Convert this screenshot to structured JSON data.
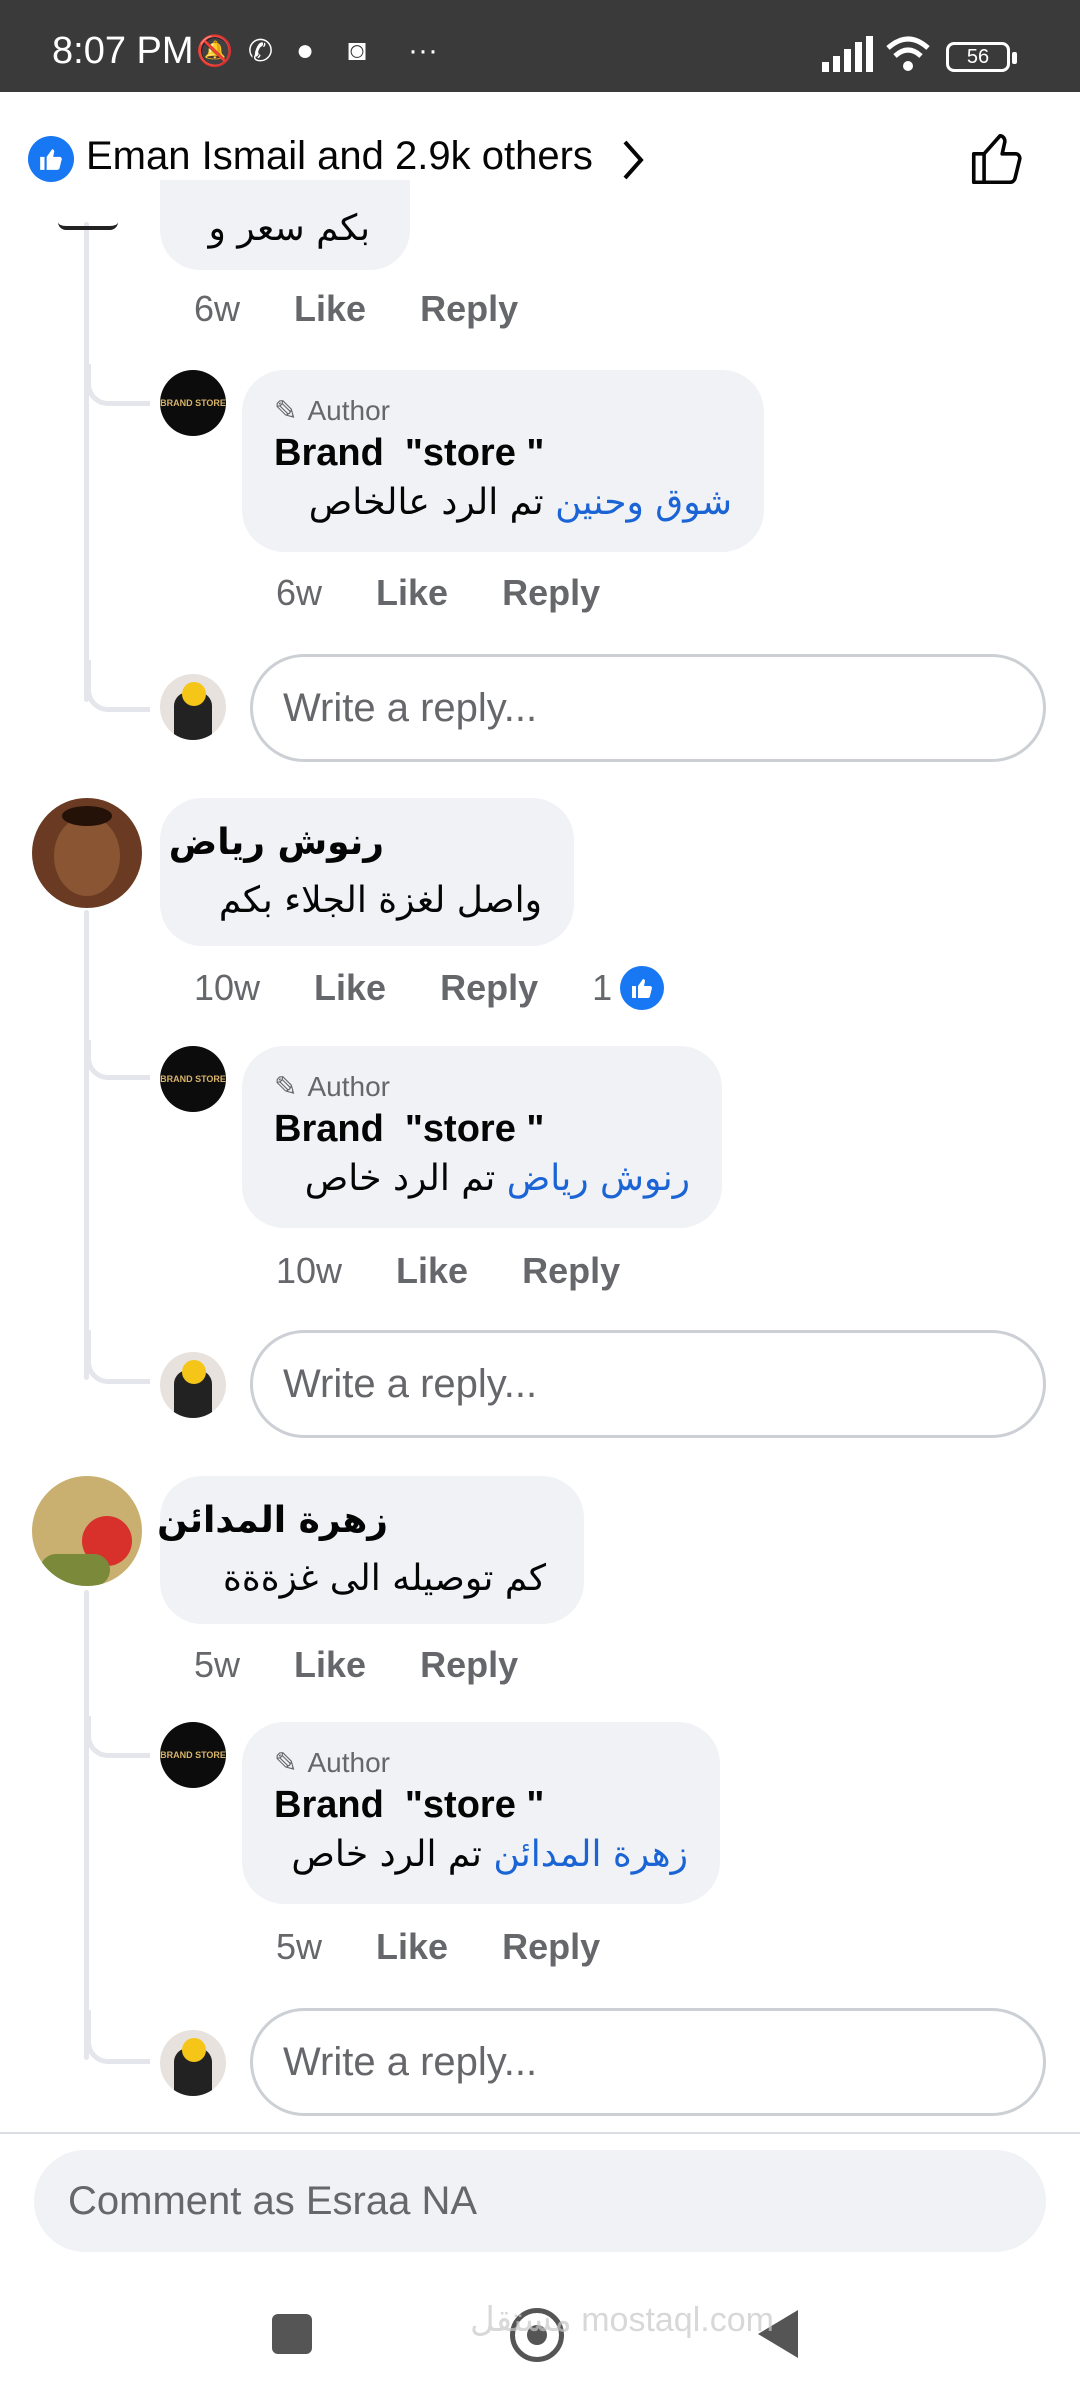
{
  "status_bar": {
    "time": "8:07 PM",
    "battery": "56"
  },
  "header": {
    "reactions_text": "Eman Ismail and 2.9k others"
  },
  "threads": [
    {
      "partial_comment_text": "بكم سعر و",
      "meta": {
        "time": "6w",
        "like": "Like",
        "reply": "Reply"
      },
      "reply": {
        "author_badge": "Author",
        "name": "Brand  \"store \"",
        "mention": "شوق وحنين",
        "text": "تم الرد عالخاص",
        "meta": {
          "time": "6w",
          "like": "Like",
          "reply": "Reply"
        }
      },
      "reply_placeholder": "Write a reply..."
    },
    {
      "commenter": "رنوش رياض",
      "comment": "واصل لغزة الجلاء بكم",
      "meta": {
        "time": "10w",
        "like": "Like",
        "reply": "Reply",
        "reactions": "1"
      },
      "reply": {
        "author_badge": "Author",
        "name": "Brand  \"store \"",
        "mention": "رنوش رياض",
        "text": "تم الرد خاص",
        "meta": {
          "time": "10w",
          "like": "Like",
          "reply": "Reply"
        }
      },
      "reply_placeholder": "Write a reply..."
    },
    {
      "commenter": "زهرة المدائن",
      "comment": "كم توصيله  الى غزةةة",
      "meta": {
        "time": "5w",
        "like": "Like",
        "reply": "Reply"
      },
      "reply": {
        "author_badge": "Author",
        "name": "Brand  \"store \"",
        "mention": "زهرة المدائن",
        "text": "تم الرد خاص",
        "meta": {
          "time": "5w",
          "like": "Like",
          "reply": "Reply"
        }
      },
      "reply_placeholder": "Write a reply..."
    }
  ],
  "brand_avatar_text": "BRAND STORE",
  "comment_bar": {
    "placeholder": "Comment as Esraa NA"
  },
  "watermark": "مستقل mostaql.com",
  "colors": {
    "accent": "#1877f2",
    "mention": "#1b64d6",
    "bubble": "#f0f2f5",
    "muted": "#65676b"
  }
}
